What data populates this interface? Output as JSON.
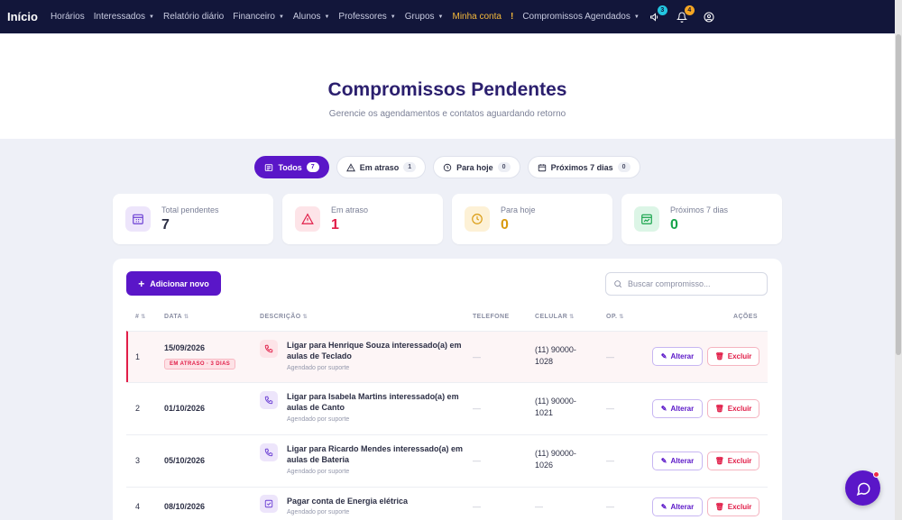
{
  "nav": {
    "brand": "Início",
    "items": [
      {
        "label": "Horários",
        "dropdown": false
      },
      {
        "label": "Interessados",
        "dropdown": true
      },
      {
        "label": "Relatório diário",
        "dropdown": false
      },
      {
        "label": "Financeiro",
        "dropdown": true
      },
      {
        "label": "Alunos",
        "dropdown": true
      },
      {
        "label": "Professores",
        "dropdown": true
      },
      {
        "label": "Grupos",
        "dropdown": true
      }
    ],
    "account_label": "Minha conta",
    "warn_label": "!",
    "commitments_label": "Compromissos Agendados",
    "announcements_badge": "3",
    "notifications_badge": "4"
  },
  "header": {
    "title": "Compromissos Pendentes",
    "subtitle": "Gerencie os agendamentos e contatos aguardando retorno"
  },
  "tabs": [
    {
      "label": "Todos",
      "count": "7",
      "icon": "list-icon",
      "active": true
    },
    {
      "label": "Em atraso",
      "count": "1",
      "icon": "warning-icon",
      "active": false
    },
    {
      "label": "Para hoje",
      "count": "0",
      "icon": "clock-icon",
      "active": false
    },
    {
      "label": "Próximos 7 dias",
      "count": "0",
      "icon": "calendar-icon",
      "active": false
    }
  ],
  "stats": [
    {
      "label": "Total pendentes",
      "value": "7",
      "icon": "calendar-grid-icon",
      "color": "#2c2f45",
      "bg": "#ede5fb",
      "accent": "#6b3fd4"
    },
    {
      "label": "Em atraso",
      "value": "1",
      "icon": "warning-icon",
      "color": "#e11d48",
      "bg": "#fde4e8",
      "accent": "#e11d48"
    },
    {
      "label": "Para hoje",
      "value": "0",
      "icon": "clock-icon",
      "color": "#d99a0e",
      "bg": "#fdf1d6",
      "accent": "#d99a0e"
    },
    {
      "label": "Próximos 7 dias",
      "value": "0",
      "icon": "calendar-chart-icon",
      "color": "#16a34a",
      "bg": "#dcf5e6",
      "accent": "#16a34a"
    }
  ],
  "toolbar": {
    "add_label": "Adicionar novo",
    "search_placeholder": "Buscar compromisso..."
  },
  "table": {
    "columns": {
      "num": "#",
      "date": "DATA",
      "description": "DESCRIÇÃO",
      "phone": "TELEFONE",
      "mobile": "CELULAR",
      "op": "OP.",
      "actions": "AÇÕES"
    },
    "edit_label": "Alterar",
    "delete_label": "Excluir",
    "rows": [
      {
        "num": "1",
        "date": "15/09/2026",
        "late_tag": "EM ATRASO · 3 DIAS",
        "title": "Ligar para Henrique Souza interessado(a) em aulas de Teclado",
        "subtitle": "Agendado por suporte",
        "icon": "phone-icon",
        "phone": "—",
        "mobile": "(11) 90000-1028",
        "op": "—",
        "late": true
      },
      {
        "num": "2",
        "date": "01/10/2026",
        "late_tag": "",
        "title": "Ligar para Isabela Martins interessado(a) em aulas de Canto",
        "subtitle": "Agendado por suporte",
        "icon": "phone-icon",
        "phone": "—",
        "mobile": "(11) 90000-1021",
        "op": "—",
        "late": false
      },
      {
        "num": "3",
        "date": "05/10/2026",
        "late_tag": "",
        "title": "Ligar para Ricardo Mendes interessado(a) em aulas de Bateria",
        "subtitle": "Agendado por suporte",
        "icon": "phone-icon",
        "phone": "—",
        "mobile": "(11) 90000-1026",
        "op": "—",
        "late": false
      },
      {
        "num": "4",
        "date": "08/10/2026",
        "late_tag": "",
        "title": "Pagar conta de Energia elétrica",
        "subtitle": "Agendado por suporte",
        "icon": "checkbox-icon",
        "phone": "—",
        "mobile": "—",
        "op": "—",
        "late": false
      }
    ]
  }
}
